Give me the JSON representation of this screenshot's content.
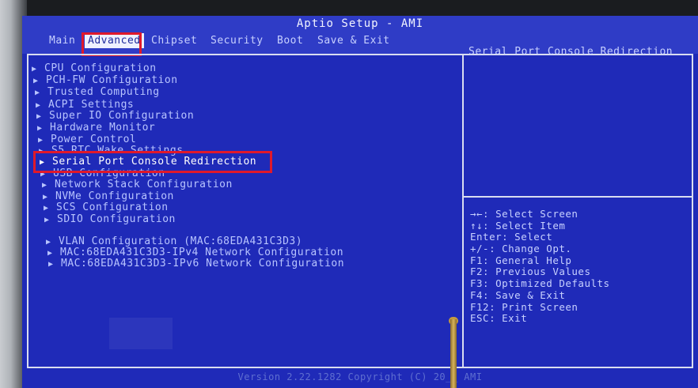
{
  "header": {
    "title": "Aptio Setup - AMI"
  },
  "tabs": [
    {
      "label": "Main"
    },
    {
      "label": "Advanced"
    },
    {
      "label": "Chipset"
    },
    {
      "label": "Security"
    },
    {
      "label": "Boot"
    },
    {
      "label": "Save & Exit"
    }
  ],
  "active_tab": "Advanced",
  "menu": {
    "items": [
      {
        "label": "CPU Configuration"
      },
      {
        "label": "PCH-FW Configuration"
      },
      {
        "label": "Trusted Computing"
      },
      {
        "label": "ACPI Settings"
      },
      {
        "label": "Super IO Configuration"
      },
      {
        "label": "Hardware Monitor"
      },
      {
        "label": "Power Control"
      },
      {
        "label": "S5 RTC Wake Settings"
      },
      {
        "label": "Serial Port Console Redirection"
      },
      {
        "label": "USB Configuration"
      },
      {
        "label": "Network Stack Configuration"
      },
      {
        "label": "NVMe Configuration"
      },
      {
        "label": "SCS Configuration"
      },
      {
        "label": "SDIO Configuration"
      },
      {
        "label": "VLAN Configuration (MAC:68EDA431C3D3)"
      },
      {
        "label": "MAC:68EDA431C3D3-IPv4 Network Configuration"
      },
      {
        "label": "MAC:68EDA431C3D3-IPv6 Network Configuration"
      }
    ],
    "selected": "Serial Port Console Redirection"
  },
  "help": {
    "description": "Serial Port Console Redirection",
    "keys": [
      "→←: Select Screen",
      "↑↓: Select Item",
      "Enter: Select",
      "+/-: Change Opt.",
      "F1: General Help",
      "F2: Previous Values",
      "F3: Optimized Defaults",
      "F4: Save & Exit",
      "F12: Print Screen",
      "ESC: Exit"
    ]
  },
  "footer": {
    "text": "Version 2.22.1282 Copyright (C) 20__ AMI"
  },
  "colors": {
    "background": "#1f2ab8",
    "text": "#b8c4ff",
    "highlight": "#e0192b",
    "active_tab_bg": "#eef0ff"
  }
}
